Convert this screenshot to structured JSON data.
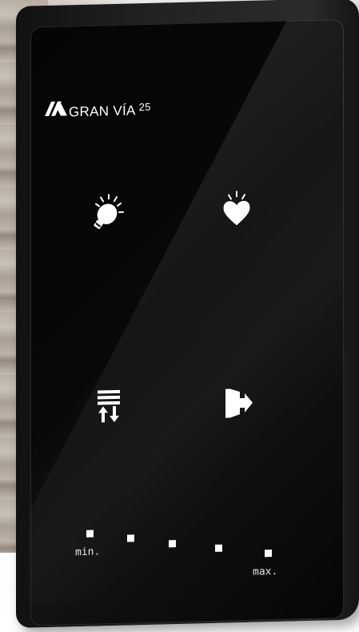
{
  "brand": {
    "name": "GRAN VÍA",
    "number": "25"
  },
  "buttons": [
    {
      "name": "light",
      "icon": "lightbulb-icon"
    },
    {
      "name": "scene",
      "icon": "heart-icon"
    },
    {
      "name": "blinds",
      "icon": "blinds-icon"
    },
    {
      "name": "exit",
      "icon": "door-exit-icon"
    }
  ],
  "level_indicator": {
    "leds": 5,
    "min_label": "min.",
    "max_label": "max."
  },
  "colors": {
    "panel": "#050505",
    "icon": "#ffffff",
    "frame": "#1e1e1e"
  }
}
